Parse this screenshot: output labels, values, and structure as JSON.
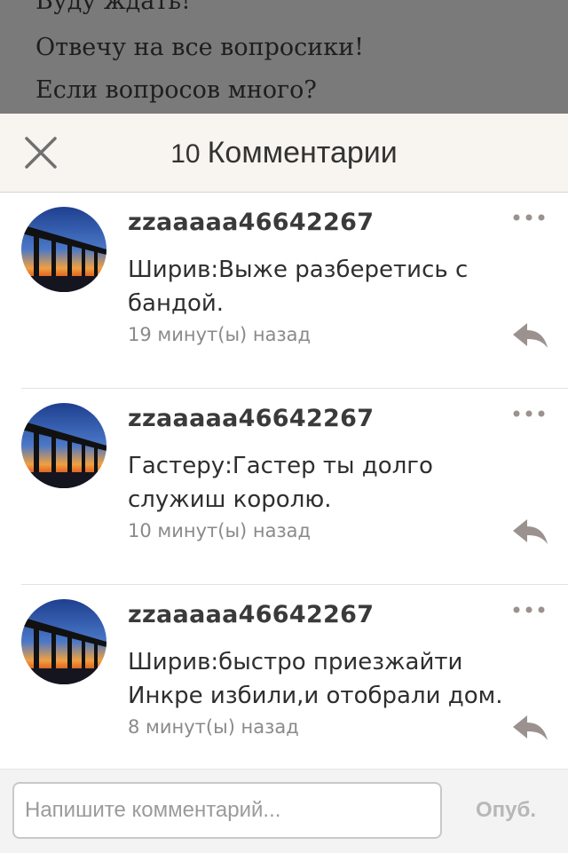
{
  "backdrop": {
    "lines": [
      "Буду ждать!",
      "Отвечу на все вопросики!",
      "Если вопросов много?"
    ]
  },
  "header": {
    "count": "10",
    "title": "Комментарии"
  },
  "comments": [
    {
      "author": "zzaaaaa46642267",
      "text": "Ширив:Выже разберетись с бандой.",
      "time": "19 минут(ы) назад"
    },
    {
      "author": "zzaaaaa46642267",
      "text": "Гастеру:Гастер ты долго служиш королю.",
      "time": "10 минут(ы) назад"
    },
    {
      "author": "zzaaaaa46642267",
      "text": "Ширив:быстро приезжайти Инкре избили,и отобрали дом.",
      "time": "8 минут(ы) назад"
    }
  ],
  "input": {
    "placeholder": "Напишите комментарий...",
    "value": ""
  },
  "publish_label": "Опуб.",
  "colors": {
    "header_bg": "#f8f5f0",
    "backdrop": "#7a7a7a",
    "icon_gray": "#9b928f"
  },
  "icons": {
    "close": "close-icon",
    "more": "more-icon",
    "reply": "reply-icon"
  }
}
